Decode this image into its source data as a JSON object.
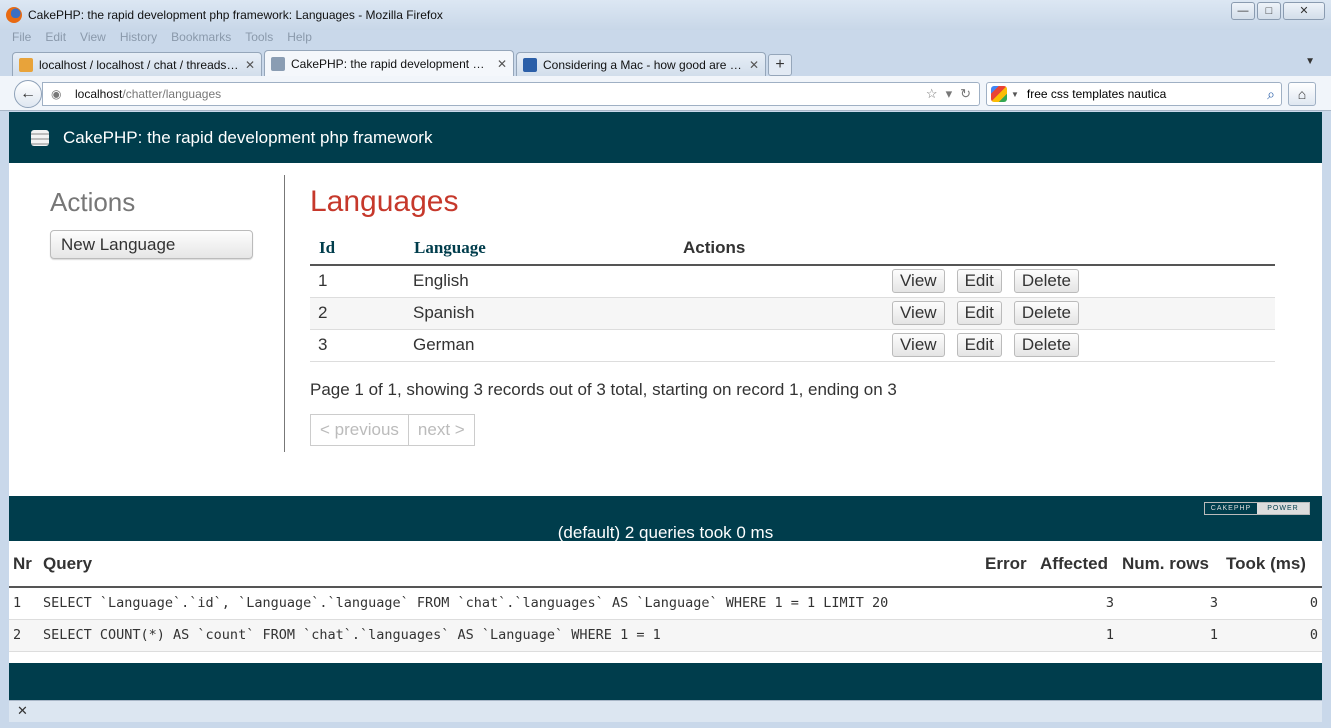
{
  "window": {
    "title": "CakePHP: the rapid development php framework: Languages - Mozilla Firefox",
    "controls": [
      "—",
      "□",
      "✕"
    ]
  },
  "menu": [
    "File",
    "Edit",
    "View",
    "History",
    "Bookmarks",
    "Tools",
    "Help"
  ],
  "tabs": [
    {
      "label": "localhost / localhost / chat / threads |...",
      "close": "✕",
      "favicon_color": "#e8a33a"
    },
    {
      "label": "CakePHP: the rapid development ph...",
      "close": "✕",
      "favicon_color": "#8a9db3"
    },
    {
      "label": "Considering a Mac - how good are th...",
      "close": "✕",
      "favicon_color": "#2b5fa8"
    }
  ],
  "new_tab": "+",
  "url": {
    "host": "localhost",
    "path": "/chatter/languages"
  },
  "search": {
    "value": "free css templates nautica"
  },
  "site": {
    "header": "CakePHP: the rapid development php framework"
  },
  "sidebar": {
    "heading": "Actions",
    "new_language": "New Language"
  },
  "main": {
    "title": "Languages",
    "columns": [
      "Id",
      "Language",
      "Actions"
    ],
    "rows": [
      {
        "id": "1",
        "language": "English"
      },
      {
        "id": "2",
        "language": "Spanish"
      },
      {
        "id": "3",
        "language": "German"
      }
    ],
    "row_buttons": {
      "view": "View",
      "edit": "Edit",
      "delete": "Delete"
    },
    "paging_text": "Page 1 of 1, showing 3 records out of 3 total, starting on record 1, ending on 3",
    "prev": "< previous",
    "next": "next >"
  },
  "footer": {
    "badge_left": "CAKEPHP",
    "badge_right": "POWER"
  },
  "sql": {
    "caption": "(default) 2 queries took 0 ms",
    "headers": {
      "nr": "Nr",
      "query": "Query",
      "error": "Error",
      "affected": "Affected",
      "num_rows": "Num. rows",
      "took": "Took (ms)"
    },
    "rows": [
      {
        "nr": "1",
        "query": "SELECT `Language`.`id`, `Language`.`language` FROM `chat`.`languages` AS `Language` WHERE 1 = 1 LIMIT 20",
        "error": "",
        "affected": "3",
        "num_rows": "3",
        "took": "0"
      },
      {
        "nr": "2",
        "query": "SELECT COUNT(*) AS `count` FROM `chat`.`languages` AS `Language` WHERE 1 = 1",
        "error": "",
        "affected": "1",
        "num_rows": "1",
        "took": "0"
      }
    ]
  },
  "statusbar": {
    "close": "✕"
  },
  "colors": {
    "header_bg": "#003d4c",
    "title_red": "#c6382b"
  }
}
